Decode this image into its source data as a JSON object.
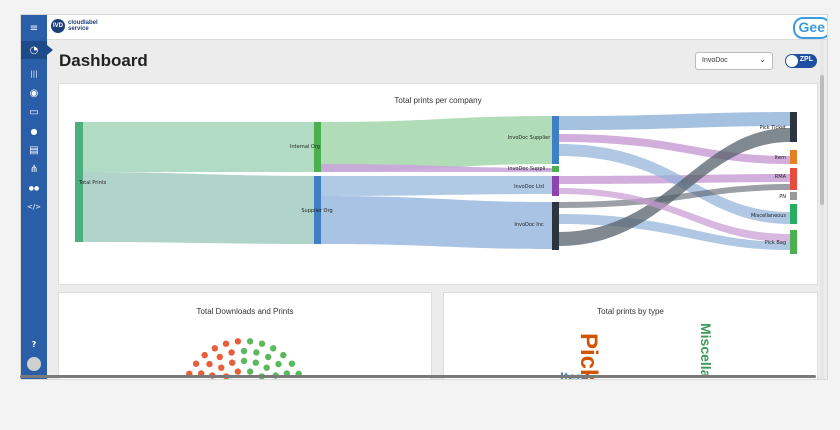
{
  "header": {
    "brand_mark": "IVD",
    "brand_line1": "cloudlabel",
    "brand_line2": "service",
    "logo_right": "Gee"
  },
  "sidebar": {
    "items": [
      {
        "icon": "menu-icon",
        "glyph": "≡"
      },
      {
        "icon": "dashboard-icon",
        "glyph": "◔"
      },
      {
        "icon": "barcode-icon",
        "glyph": "|||"
      },
      {
        "icon": "globe-icon",
        "glyph": "◉"
      },
      {
        "icon": "printer-icon",
        "glyph": "▭"
      },
      {
        "icon": "user-icon",
        "glyph": "●"
      },
      {
        "icon": "document-icon",
        "glyph": "▤"
      },
      {
        "icon": "hierarchy-icon",
        "glyph": "⋔"
      },
      {
        "icon": "users-icon",
        "glyph": "●●"
      },
      {
        "icon": "code-icon",
        "glyph": "</>"
      }
    ],
    "help_glyph": "?",
    "avatar_glyph": "◍"
  },
  "page": {
    "title": "Dashboard"
  },
  "controls": {
    "company_select": "InvoDoc",
    "toggle_label": "ZPL"
  },
  "cards": {
    "sankey_title": "Total prints per company",
    "downloads_title": "Total Downloads and Prints",
    "bytype_title": "Total prints by type"
  },
  "sankey": {
    "nodes": [
      "Total Prints",
      "Internal Org",
      "Supplier Org",
      "InvoDoc Supplier",
      "InvoDoc Suppli...",
      "InvoDoc Ltd",
      "InvoDoc Inc",
      "Pick Ticket",
      "Item",
      "RMA",
      "PN",
      "Miscellaneous",
      "Pick Bag"
    ],
    "colors": {
      "total": "#4caf7d",
      "internal": "#4caf50",
      "supplier": "#3f7fc4",
      "dark": "#2c3440",
      "purple": "#8e44ad",
      "orange": "#e67e22",
      "red": "#e74c3c",
      "green": "#27ae60"
    }
  },
  "wordcloud": {
    "words": [
      "Pick",
      "Miscella",
      "Item"
    ]
  },
  "colors": {
    "accent": "#2a5ea8",
    "orange_dot": "#e85d3a",
    "green_dot": "#5cb85c",
    "yellow_dot": "#c8d44a"
  }
}
